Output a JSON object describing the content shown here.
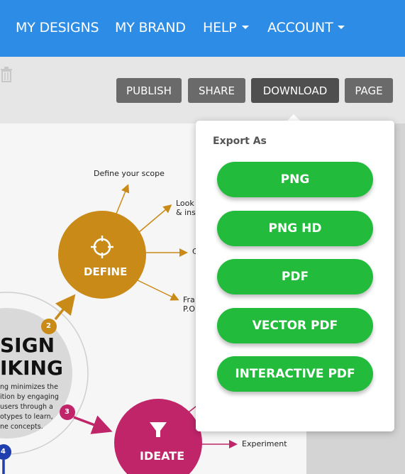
{
  "nav": {
    "items": [
      {
        "label": "MY DESIGNS",
        "dropdown": false
      },
      {
        "label": "MY BRAND",
        "dropdown": false
      },
      {
        "label": "HELP",
        "dropdown": true
      },
      {
        "label": "ACCOUNT",
        "dropdown": true
      }
    ],
    "color": "#2d8ce6"
  },
  "toolbar": {
    "publish": "PUBLISH",
    "share": "SHARE",
    "download": "DOWNLOAD",
    "page": "PAGE"
  },
  "export_menu": {
    "title": "Export As",
    "options": [
      "PNG",
      "PNG HD",
      "PDF",
      "VECTOR PDF",
      "INTERACTIVE PDF"
    ],
    "button_color": "#22bb3b"
  },
  "canvas": {
    "define_label": "DEFINE",
    "ideate_label": "IDEATE",
    "define_color": "#c98a17",
    "ideate_color": "#c0256a",
    "step_2": "2",
    "step_3": "3",
    "step_4": "4",
    "title_line1": "SIGN",
    "title_line2": "IKING",
    "body_text": [
      "ng minimizes the",
      "ition by engaging",
      "users through a",
      "otypes to learn,",
      "ne concepts."
    ],
    "scope_text": "Define your scope",
    "look_text_1": "Look",
    "look_text_2": "& insi",
    "c_text": "C",
    "fra_text_1": "Fra",
    "fra_text_2": "P.O",
    "experiment_text": "Experiment"
  }
}
